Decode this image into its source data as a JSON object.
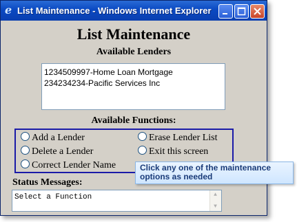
{
  "window": {
    "title": "List Maintenance - Windows Internet Explorer"
  },
  "page": {
    "heading": "List Maintenance",
    "lenders_label": "Available Lenders",
    "lenders": [
      "1234509997-Home Loan Mortgage",
      "234234234-Pacific Services Inc"
    ],
    "functions_label": "Available Functions:",
    "functions": {
      "add": "Add a Lender",
      "delete": "Delete a Lender",
      "correct": "Correct Lender Name",
      "erase": "Erase Lender List",
      "exit": "Exit this screen"
    },
    "status_label": "Status Messages:",
    "status_value": "Select a Function"
  },
  "tooltip": {
    "line1": "Click any one of the maintenance",
    "line2": "options as needed"
  }
}
